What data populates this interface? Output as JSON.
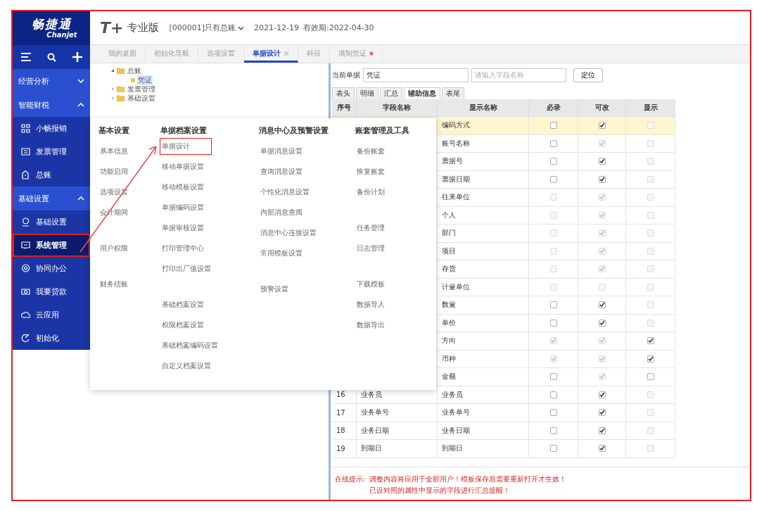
{
  "brand": {
    "name": "畅捷通",
    "latin": "Chanjet"
  },
  "sidebar": {
    "items": [
      {
        "kind": "group",
        "label": "经营分析",
        "expanded": false
      },
      {
        "kind": "group",
        "label": "智能财税",
        "expanded": true
      },
      {
        "kind": "item",
        "label": "小畅报销",
        "selected": false,
        "annotated": false
      },
      {
        "kind": "item",
        "label": "发票管理",
        "selected": false,
        "annotated": false
      },
      {
        "kind": "item",
        "label": "总账",
        "selected": false,
        "annotated": false
      },
      {
        "kind": "group",
        "label": "基础设置",
        "expanded": true
      },
      {
        "kind": "item",
        "label": "基础设置",
        "selected": false,
        "annotated": false
      },
      {
        "kind": "item",
        "label": "系统管理",
        "selected": true,
        "annotated": true
      },
      {
        "kind": "item",
        "label": "协同办公",
        "selected": false,
        "annotated": false
      },
      {
        "kind": "item",
        "label": "我要贷款",
        "selected": false,
        "annotated": false
      },
      {
        "kind": "item",
        "label": "云应用",
        "selected": false,
        "annotated": false
      },
      {
        "kind": "item",
        "label": "初始化",
        "selected": false,
        "annotated": false
      }
    ]
  },
  "header": {
    "logo_mark": "T+",
    "edition": "专业版",
    "account": "[000001]只有总账",
    "date": "2021-12-19",
    "validity": "有效期:2022-04-30"
  },
  "tabs": [
    {
      "label": "我的桌面",
      "selected": false,
      "closable": false,
      "modified": false
    },
    {
      "label": "初始化导航",
      "selected": false,
      "closable": false,
      "modified": false
    },
    {
      "label": "选项设置",
      "selected": false,
      "closable": false,
      "modified": false
    },
    {
      "label": "单据设计",
      "selected": true,
      "closable": true,
      "modified": false
    },
    {
      "label": "科目",
      "selected": false,
      "closable": false,
      "modified": false
    },
    {
      "label": "填制凭证",
      "selected": false,
      "closable": false,
      "modified": true
    }
  ],
  "tree": [
    {
      "label": "总账",
      "expanded": true,
      "selected": false,
      "children": [
        {
          "label": "凭证",
          "selected": true
        }
      ]
    },
    {
      "label": "发票管理",
      "expanded": false,
      "selected": false
    },
    {
      "label": "基础设置",
      "expanded": false,
      "selected": false
    }
  ],
  "designer": {
    "doc_label": "当前单据",
    "doc_value": "凭证",
    "search_placeholder": "请输入字段名称",
    "locate_button": "定位",
    "subtabs": [
      {
        "label": "表头",
        "selected": false
      },
      {
        "label": "明细",
        "selected": false
      },
      {
        "label": "汇总",
        "selected": false
      },
      {
        "label": "辅助信息",
        "selected": true
      },
      {
        "label": "表尾",
        "selected": false
      }
    ],
    "columns": [
      "序号",
      "字段名称",
      "显示名称",
      "必录",
      "可改",
      "显示"
    ],
    "rows": [
      {
        "display": "编码方式",
        "highlighted": true,
        "required": {
          "checked": false,
          "disabled": false
        },
        "editable": {
          "checked": true,
          "disabled": false
        },
        "visible": {
          "checked": false,
          "disabled": true
        }
      },
      {
        "display": "账号名称",
        "highlighted": false,
        "required": {
          "checked": false,
          "disabled": false
        },
        "editable": {
          "checked": true,
          "disabled": true
        },
        "visible": {
          "checked": false,
          "disabled": true
        }
      },
      {
        "display": "票据号",
        "highlighted": false,
        "required": {
          "checked": false,
          "disabled": false
        },
        "editable": {
          "checked": true,
          "disabled": false
        },
        "visible": {
          "checked": false,
          "disabled": true
        }
      },
      {
        "display": "票据日期",
        "highlighted": false,
        "required": {
          "checked": false,
          "disabled": false
        },
        "editable": {
          "checked": true,
          "disabled": false
        },
        "visible": {
          "checked": false,
          "disabled": true
        }
      },
      {
        "display": "往来单位",
        "highlighted": false,
        "required": {
          "checked": false,
          "disabled": true
        },
        "editable": {
          "checked": true,
          "disabled": true
        },
        "visible": {
          "checked": false,
          "disabled": true
        }
      },
      {
        "display": "个人",
        "highlighted": false,
        "required": {
          "checked": false,
          "disabled": true
        },
        "editable": {
          "checked": true,
          "disabled": true
        },
        "visible": {
          "checked": false,
          "disabled": true
        }
      },
      {
        "display": "部门",
        "highlighted": false,
        "required": {
          "checked": false,
          "disabled": true
        },
        "editable": {
          "checked": true,
          "disabled": true
        },
        "visible": {
          "checked": false,
          "disabled": true
        }
      },
      {
        "display": "项目",
        "highlighted": false,
        "required": {
          "checked": false,
          "disabled": true
        },
        "editable": {
          "checked": true,
          "disabled": true
        },
        "visible": {
          "checked": false,
          "disabled": true
        }
      },
      {
        "display": "存货",
        "highlighted": false,
        "required": {
          "checked": false,
          "disabled": true
        },
        "editable": {
          "checked": true,
          "disabled": true
        },
        "visible": {
          "checked": false,
          "disabled": true
        }
      },
      {
        "display": "计量单位",
        "highlighted": false,
        "required": {
          "checked": false,
          "disabled": true
        },
        "editable": {
          "checked": false,
          "disabled": true
        },
        "visible": {
          "checked": false,
          "disabled": true
        }
      },
      {
        "display": "数量",
        "highlighted": false,
        "required": {
          "checked": false,
          "disabled": false
        },
        "editable": {
          "checked": true,
          "disabled": false
        },
        "visible": {
          "checked": false,
          "disabled": true
        }
      },
      {
        "display": "单价",
        "highlighted": false,
        "required": {
          "checked": false,
          "disabled": false
        },
        "editable": {
          "checked": true,
          "disabled": false
        },
        "visible": {
          "checked": false,
          "disabled": true
        }
      },
      {
        "display": "方向",
        "highlighted": false,
        "required": {
          "checked": true,
          "disabled": true
        },
        "editable": {
          "checked": true,
          "disabled": true
        },
        "visible": {
          "checked": true,
          "disabled": false
        }
      },
      {
        "display": "币种",
        "highlighted": false,
        "required": {
          "checked": true,
          "disabled": true
        },
        "editable": {
          "checked": true,
          "disabled": true
        },
        "visible": {
          "checked": true,
          "disabled": false
        }
      },
      {
        "display": "金额",
        "highlighted": false,
        "required": {
          "checked": false,
          "disabled": false
        },
        "editable": {
          "checked": true,
          "disabled": true
        },
        "visible": {
          "checked": false,
          "disabled": false
        }
      },
      {
        "no": "16",
        "field": "业务员",
        "display": "业务员",
        "highlighted": false,
        "required": {
          "checked": false,
          "disabled": false
        },
        "editable": {
          "checked": true,
          "disabled": false
        },
        "visible": {
          "checked": false,
          "disabled": true
        }
      },
      {
        "no": "17",
        "field": "业务单号",
        "display": "业务单号",
        "highlighted": false,
        "required": {
          "checked": false,
          "disabled": false
        },
        "editable": {
          "checked": true,
          "disabled": false
        },
        "visible": {
          "checked": false,
          "disabled": true
        }
      },
      {
        "no": "18",
        "field": "业务日期",
        "display": "业务日期",
        "highlighted": false,
        "required": {
          "checked": false,
          "disabled": false
        },
        "editable": {
          "checked": true,
          "disabled": false
        },
        "visible": {
          "checked": false,
          "disabled": true
        }
      },
      {
        "no": "19",
        "field": "到期日",
        "display": "到期日",
        "highlighted": false,
        "required": {
          "checked": false,
          "disabled": false
        },
        "editable": {
          "checked": true,
          "disabled": false
        },
        "visible": {
          "checked": false,
          "disabled": true
        }
      }
    ],
    "hint_label": "在线提示:",
    "hint_lines": [
      "调整内容将应用于全部用户！模板保存后需要重新打开才生效！",
      "已设对照的属性中显示的字段进行汇总提醒！"
    ]
  },
  "menu": {
    "columns": [
      {
        "title": "基本设置",
        "groups": [
          [
            {
              "label": "基本信息",
              "annotated": false
            },
            {
              "label": "功能启用",
              "annotated": false
            },
            {
              "label": "选项设置",
              "annotated": false
            },
            {
              "label": "会计期间",
              "annotated": false
            }
          ],
          [
            {
              "label": "用户权限",
              "annotated": false
            }
          ],
          [
            {
              "label": "财务结账",
              "annotated": false
            }
          ]
        ]
      },
      {
        "title": "单据档案设置",
        "groups": [
          [
            {
              "label": "单据设计",
              "annotated": true
            },
            {
              "label": "移动单据设置",
              "annotated": false
            },
            {
              "label": "移动模板设置",
              "annotated": false
            },
            {
              "label": "单据编码设置",
              "annotated": false
            },
            {
              "label": "单据审核设置",
              "annotated": false
            },
            {
              "label": "打印管理中心",
              "annotated": false
            },
            {
              "label": "打印出厂值设置",
              "annotated": false
            }
          ],
          [
            {
              "label": "基础档案设置",
              "annotated": false
            },
            {
              "label": "权限档案设置",
              "annotated": false
            },
            {
              "label": "基础档案编码设置",
              "annotated": false
            },
            {
              "label": "自定义档案设置",
              "annotated": false
            }
          ]
        ]
      },
      {
        "title": "消息中心及预警设置",
        "groups": [
          [
            {
              "label": "单据消息设置",
              "annotated": false
            },
            {
              "label": "查询消息设置",
              "annotated": false
            },
            {
              "label": "个性化消息设置",
              "annotated": false
            },
            {
              "label": "内部消息查阅",
              "annotated": false
            },
            {
              "label": "消息中心连接设置",
              "annotated": false
            },
            {
              "label": "常用模板设置",
              "annotated": false
            }
          ],
          [
            {
              "label": "预警设置",
              "annotated": false
            }
          ]
        ]
      },
      {
        "title": "账套管理及工具",
        "groups": [
          [
            {
              "label": "备份账套",
              "annotated": false
            },
            {
              "label": "恢复账套",
              "annotated": false
            },
            {
              "label": "备份计划",
              "annotated": false
            }
          ],
          [
            {
              "label": "任务管理",
              "annotated": false
            },
            {
              "label": "日志管理",
              "annotated": false
            }
          ],
          [
            {
              "label": "下载模板",
              "annotated": false
            },
            {
              "label": "数据导入",
              "annotated": false
            },
            {
              "label": "数据导出",
              "annotated": false
            }
          ]
        ]
      }
    ]
  }
}
